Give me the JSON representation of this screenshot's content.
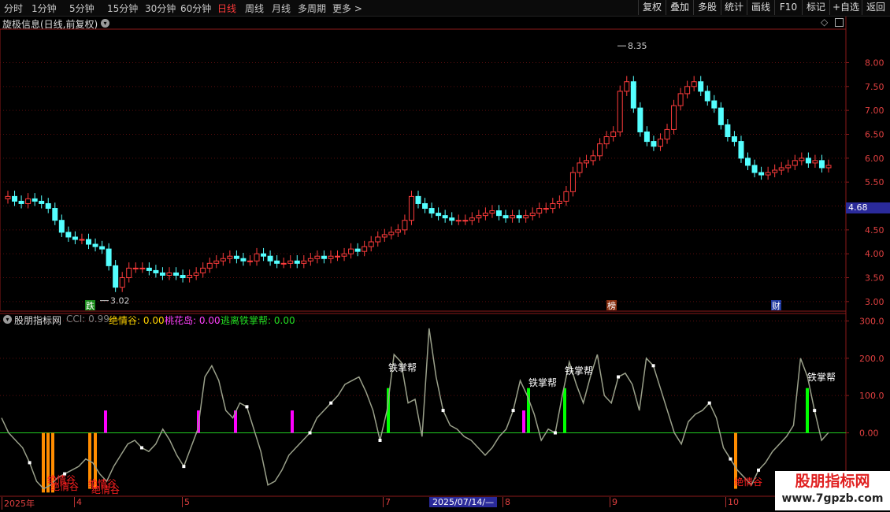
{
  "toolbar": {
    "periods": [
      "分时",
      "1分钟",
      "5分钟",
      "15分钟",
      "30分钟",
      "60分钟",
      "日线",
      "周线",
      "月线",
      "多周期",
      "更多 >"
    ],
    "active_period": "日线",
    "right_buttons": [
      "复权",
      "叠加",
      "多股",
      "统计",
      "画线",
      "F10",
      "标记",
      "+自选",
      "返回"
    ]
  },
  "main": {
    "title": "旋极信息(日线,前复权)",
    "current_price_tag": "4.68",
    "high_label": "8.35",
    "low_label": "3.02",
    "markers": [
      "跌",
      "榜",
      "财"
    ]
  },
  "indicator": {
    "title": "股朋指标网",
    "legend": [
      {
        "name": "CCI",
        "value": "0.99",
        "color": "#808080"
      },
      {
        "name": "绝情谷",
        "value": "0.00",
        "color": "#ffd400"
      },
      {
        "name": "桃花岛",
        "value": "0.00",
        "color": "#ff40ff"
      },
      {
        "name": "逃离铁掌帮",
        "value": "0.00",
        "color": "#22dd22"
      }
    ],
    "annotations": {
      "juqinggu": "绝情谷",
      "tiezhangbang": "铁掌帮"
    }
  },
  "date_axis": {
    "labels": [
      "2025年",
      "4",
      "5",
      "7",
      "8",
      "9",
      "10"
    ],
    "cursor_date": "2025/07/14/—"
  },
  "watermark": {
    "line1": "股朋指标网",
    "line2": "www.7gpzb.com"
  },
  "colors": {
    "up": "#ff3c3c",
    "down": "#54ffff",
    "cci_line": "#9aa08a",
    "zero_line": "#22cc22",
    "juqinggu_bar": "#ff8c00",
    "taohuadao_bar": "#ff00ff",
    "tiezhangbang_bar": "#00ff00"
  },
  "chart_data": [
    {
      "type": "candlestick",
      "title": "旋极信息(日线,前复权)",
      "y_ticks": [
        "3.00",
        "3.50",
        "4.00",
        "4.50",
        "5.00",
        "5.50",
        "6.00",
        "6.50",
        "7.00",
        "7.50",
        "8.00"
      ],
      "ylim": [
        2.8,
        8.7
      ],
      "x_labels": [
        "2025年",
        "4",
        "5",
        "7",
        "8",
        "9",
        "10"
      ],
      "close_series_approx": [
        5.2,
        5.1,
        5.05,
        5.15,
        5.1,
        5.05,
        4.95,
        4.7,
        4.45,
        4.35,
        4.3,
        4.3,
        4.2,
        4.15,
        4.1,
        3.75,
        3.3,
        3.5,
        3.7,
        3.7,
        3.7,
        3.65,
        3.6,
        3.55,
        3.6,
        3.55,
        3.5,
        3.55,
        3.6,
        3.7,
        3.8,
        3.85,
        3.9,
        3.95,
        3.9,
        3.85,
        3.85,
        4.0,
        3.95,
        3.85,
        3.8,
        3.8,
        3.85,
        3.8,
        3.85,
        3.9,
        3.95,
        3.9,
        3.95,
        3.95,
        4.0,
        4.1,
        4.05,
        4.15,
        4.25,
        4.35,
        4.4,
        4.45,
        4.5,
        4.7,
        5.2,
        5.05,
        4.95,
        4.85,
        4.8,
        4.75,
        4.7,
        4.7,
        4.7,
        4.75,
        4.8,
        4.85,
        4.9,
        4.8,
        4.75,
        4.8,
        4.75,
        4.8,
        4.85,
        4.95,
        4.95,
        5.05,
        5.1,
        5.3,
        5.7,
        5.9,
        5.95,
        6.05,
        6.3,
        6.45,
        6.55,
        7.4,
        7.6,
        7.05,
        6.55,
        6.35,
        6.25,
        6.4,
        6.6,
        7.1,
        7.35,
        7.5,
        7.6,
        7.4,
        7.2,
        7.05,
        6.7,
        6.45,
        6.35,
        6.0,
        5.85,
        5.7,
        5.65,
        5.7,
        5.75,
        5.8,
        5.85,
        5.95,
        6.0,
        5.9,
        5.95,
        5.8,
        5.85
      ],
      "high": 8.35,
      "low": 3.02,
      "last": 4.68
    },
    {
      "type": "line",
      "title": "股朋指标网",
      "series_name": "CCI",
      "y_ticks": [
        "0.00",
        "100.0",
        "200.0",
        "300.0"
      ],
      "ylim": [
        -170,
        320
      ],
      "values": [
        40,
        0,
        -20,
        -40,
        -80,
        -130,
        -150,
        -140,
        -120,
        -110,
        -100,
        -90,
        -70,
        -80,
        -110,
        -130,
        -90,
        -60,
        -30,
        -20,
        -40,
        -50,
        -30,
        10,
        -20,
        -60,
        -90,
        -40,
        10,
        150,
        180,
        140,
        60,
        40,
        80,
        70,
        10,
        -50,
        -140,
        -130,
        -100,
        -60,
        -40,
        -20,
        0,
        40,
        60,
        80,
        100,
        130,
        140,
        150,
        110,
        60,
        -20,
        60,
        210,
        190,
        80,
        90,
        -10,
        280,
        150,
        60,
        20,
        10,
        -10,
        -20,
        -40,
        -60,
        -40,
        -10,
        10,
        60,
        140,
        100,
        50,
        -20,
        10,
        0,
        100,
        190,
        130,
        80,
        150,
        210,
        100,
        80,
        150,
        160,
        130,
        60,
        200,
        180,
        120,
        60,
        0,
        -30,
        30,
        50,
        60,
        80,
        40,
        -40,
        -70,
        -100,
        -120,
        -140,
        -100,
        -80,
        -50,
        -30,
        -10,
        20,
        200,
        150,
        60,
        -20,
        0.99
      ]
    }
  ]
}
